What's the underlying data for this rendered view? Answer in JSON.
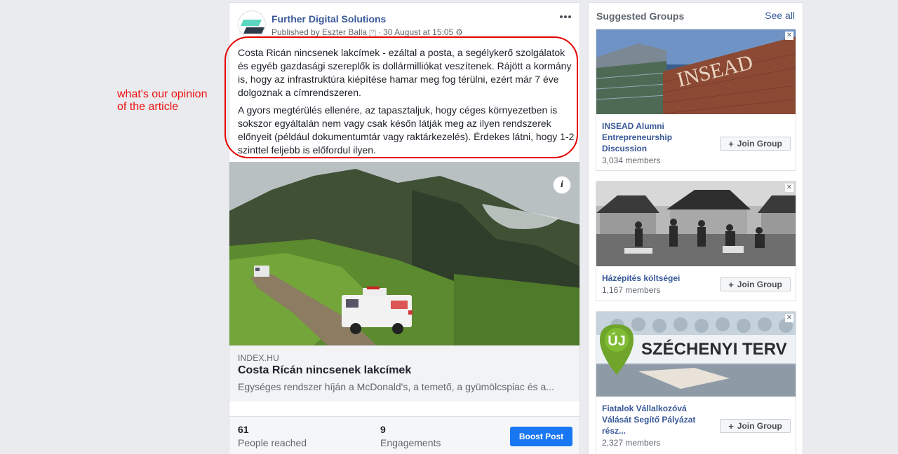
{
  "annotation": {
    "line1": "what's our opinion",
    "line2": "of the article"
  },
  "post": {
    "page_name": "Further Digital Solutions",
    "published_by": "Published by Eszter Balla",
    "question_mark": "[?]",
    "separator": "·",
    "date": "30 August at 15:05",
    "paragraph1": "Costa Ricán nincsenek lakcímek - ezáltal a posta, a segélykerő szolgálatok és egyéb gazdasági szereplők is dollármilliókat veszítenek. Rájött a kormány is, hogy az infrastruktúra kiépítése hamar meg fog térülni, ezért már 7 éve dolgoznak a címrendszeren.",
    "paragraph2": "A gyors megtérülés ellenére, az tapasztaljuk, hogy céges környezetben is sokszor egyáltalán nem vagy csak későn látják meg az ilyen rendszerek előnyeit (például dokumentumtár vagy raktárkezelés). Érdekes látni, hogy 1-2 szinttel feljebb is előfordul ilyen.",
    "link": {
      "domain": "INDEX.HU",
      "title": "Costa Rícán nincsenek lakcímek",
      "description": "Egységes rendszer híján a McDonald's, a temető, a gyümölcspiac és a..."
    },
    "info_icon": "i",
    "stats": {
      "reach_value": "61",
      "reach_label": "People reached",
      "engagements_value": "9",
      "engagements_label": "Engagements",
      "boost_label": "Boost Post"
    }
  },
  "sidebar": {
    "title": "Suggested Groups",
    "see_all": "See all",
    "join_label": "Join Group",
    "close_icon": "✕",
    "plus_icon": "+",
    "groups": [
      {
        "name": "INSEAD Alumni Entrepreneurship Discussion",
        "members": "3,034 members",
        "image_text": "INSEAD"
      },
      {
        "name": "Házépítés költségei",
        "members": "1,167 members"
      },
      {
        "name": "Fiatalok Vállalkozóvá Válását Segítő Pályázat rész...",
        "members": "2,327 members",
        "image_text_uj": "ÚJ",
        "image_text_main": "SZÉCHENYI TERV"
      }
    ]
  },
  "colors": {
    "link_blue": "#385898",
    "boost_blue": "#1877f2",
    "annotation_red": "#ee1111"
  }
}
